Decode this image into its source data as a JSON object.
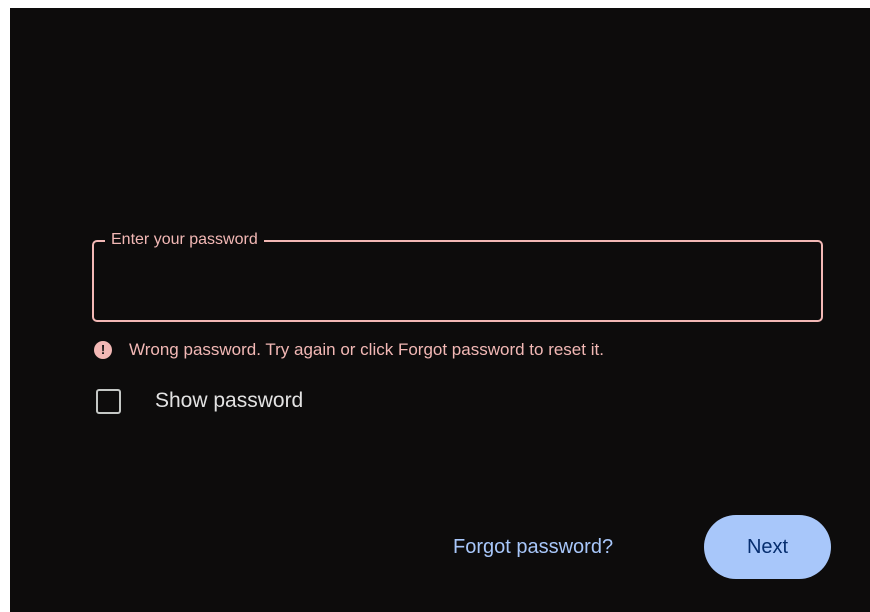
{
  "password_field": {
    "label": "Enter your password",
    "value": "",
    "state_color": "#f2b8b5"
  },
  "error": {
    "icon": "error-icon",
    "icon_glyph": "!",
    "message": "Wrong password. Try again or click Forgot password to reset it."
  },
  "show_password": {
    "label": "Show password",
    "checked": false
  },
  "actions": {
    "forgot_label": "Forgot password?",
    "next_label": "Next"
  },
  "colors": {
    "background": "#0d0c0c",
    "error": "#f2b8b5",
    "primary": "#a8c7fa",
    "on_primary": "#062e6f",
    "text": "#e3e3e3"
  }
}
